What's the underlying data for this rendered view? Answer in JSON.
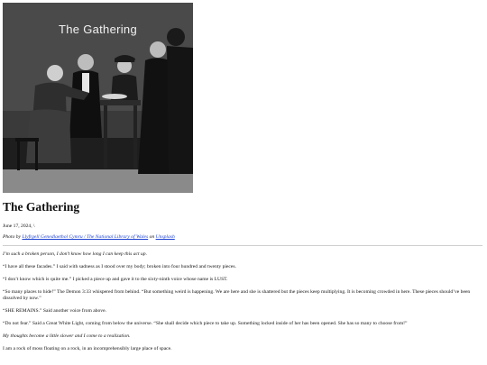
{
  "hero": {
    "title": "The Gathering",
    "icon": "photo-illustration"
  },
  "post": {
    "title": "The Gathering",
    "date": "June 17, 2024, \\",
    "credit": {
      "prefix": "Photo by",
      "author": "Llyfrgell Genedlaethol Cymru / The National Library of Wales",
      "middle": "on",
      "source": "Unsplash"
    },
    "paragraphs": [
      {
        "text": "I’m such a broken person, I don’t know how long I can keep this act up.",
        "italic": true
      },
      {
        "text": "“I have all these facades.” I said with sadness as I stood over my body; broken into four hundred and twenty pieces.",
        "italic": false
      },
      {
        "text": "“I don’t know which is quite me.” I picked a piece up and gave it to the sixty-ninth voice whose name is LUST.",
        "italic": false
      },
      {
        "text": "“So many places to hide!” The Demon 3:33 whispered from behind. “But something weird is happening. We are here and she is shattered but the pieces keep multiplying. It is becoming crowded in here. These pieces should’ve been dissolved by now.”",
        "italic": false
      },
      {
        "text": "“SHE REMAINS.” Said another voice from above.",
        "italic": false
      },
      {
        "text": "“Do not fear.” Said a Great White Light, coming from below the universe. “She shall decide which piece to take up. Something locked inside of her has been opened. She has so many to choose from!”",
        "italic": false
      },
      {
        "text": "My thoughts become a little slower and I come to a realization.",
        "italic": true
      },
      {
        "text": "I am a rock of moss floating on a rock, in an incomprehensibly large place of space.",
        "italic": false
      }
    ]
  }
}
